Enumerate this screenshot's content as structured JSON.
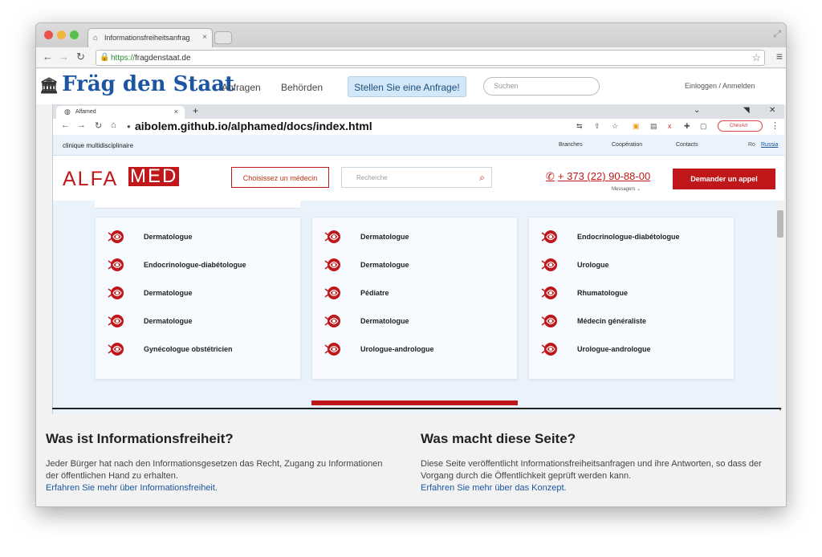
{
  "outer_browser": {
    "tab_title": "Informationsfreiheitsanfrag",
    "url_scheme": "https://",
    "url_host": "fragdenstaat.de"
  },
  "fds": {
    "logo": "Fräg den Staat",
    "nav": [
      "Anfragen",
      "Behörden"
    ],
    "cta": "Stellen Sie eine Anfrage!",
    "search_placeholder": "Suchen",
    "login": "Einloggen / Anmelden"
  },
  "inner_browser": {
    "tab_title": "Alfamed",
    "url": "aibolem.github.io/alphamed/docs/index.html",
    "ext_chip": "ChiroArt"
  },
  "site": {
    "tagline": "clinique multidisciplinaire",
    "top_links": [
      "Branches",
      "Coopération",
      "Contacts"
    ],
    "langs": [
      "Ro",
      "Russia"
    ],
    "logo_left": "ALFA",
    "logo_right": "MED",
    "choose_button": "Choisissez un médecin",
    "search_placeholder": "Recherche",
    "phone": "+ 373 (22) 90-88-00",
    "messenger": "Messagers ⌄",
    "callback": "Demander un appel",
    "accent_color": "#c0171b"
  },
  "specialties": [
    [
      "Dermatologue",
      "Endocrinologue-diabétologue",
      "Dermatologue",
      "Dermatologue",
      "Gynécologue obstétricien"
    ],
    [
      "Dermatologue",
      "Dermatologue",
      "Pédiatre",
      "Dermatologue",
      "Urologue-andrologue"
    ],
    [
      "Endocrinologue-diabétologue",
      "Urologue",
      "Rhumatologue",
      "Médecin généraliste",
      "Urologue-andrologue"
    ]
  ],
  "info": {
    "left": {
      "title": "Was ist Informationsfreiheit?",
      "text": "Jeder Bürger hat nach den Informationsgesetzen das Recht, Zugang zu Informationen der öffentlichen Hand zu erhalten.",
      "link": "Erfahren Sie mehr über Informationsfreiheit."
    },
    "right": {
      "title": "Was macht diese Seite?",
      "text": "Diese Seite veröffentlicht Informationsfreiheitsanfragen und ihre Antworten, so dass der Vorgang durch die Öffentlichkeit geprüft werden kann.",
      "link": "Erfahren Sie mehr über das Konzept."
    }
  }
}
